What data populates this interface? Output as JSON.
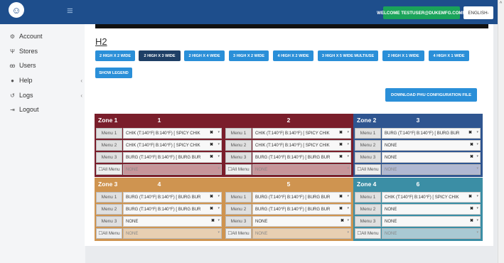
{
  "topbar": {
    "welcome": "WELCOME TESTUSER@DUKEMFG.COM!▾",
    "language": "ENGLISH-"
  },
  "sidebar": {
    "items": [
      {
        "label": "Account",
        "icon": "gear-icon"
      },
      {
        "label": "Stores",
        "icon": "stores-icon"
      },
      {
        "label": "Users",
        "icon": "users-icon"
      },
      {
        "label": "Help",
        "icon": "help-icon"
      },
      {
        "label": "Logs",
        "icon": "logs-icon"
      },
      {
        "label": "Logout",
        "icon": "logout-icon"
      }
    ]
  },
  "main": {
    "title": "H2",
    "layout_buttons": [
      "2 HIGH X 2 WIDE",
      "2 HIGH X 3 WIDE",
      "2 HIGH X 4 WIDE",
      "3 HIGH X 2 WIDE",
      "4 HIGH X 2 WIDE",
      "3 HIGH X 5 WIDE MULTIUSE",
      "2 HIGH X 1 WIDE",
      "4 HIGH X 1 WIDE"
    ],
    "active_layout": "2 HIGH X 3 WIDE",
    "legend_button": "SHOW LEGEND",
    "download_button": "DOWNLOAD PHU CONFIGURATION FILE"
  },
  "colors": {
    "zone1": "#7a1e2b",
    "zone1_bg": "#c7959a",
    "zone2": "#2f5590",
    "zone2_bg": "#b0b8d2",
    "zone3": "#cf9450",
    "zone3_bg": "#e8cfb2",
    "zone4": "#3b8ea5",
    "zone4_bg": "#a9c9d3"
  },
  "blocks": [
    {
      "zone": "Zone 1",
      "num": "1",
      "menus": [
        {
          "label": "Menu 1",
          "value": "CHIK (T:140°F| B:140°F) [ SPICY CHIK"
        },
        {
          "label": "Menu 2",
          "value": "CHIK (T:140°F| B:140°F) [ SPICY CHIK"
        },
        {
          "label": "Menu 3",
          "value": "BURG (T:140°F| B:140°F) [ BURG BUR"
        }
      ],
      "all_label": "☐All Menu",
      "all_value": "NONE"
    },
    {
      "zone": "",
      "num": "2",
      "menus": [
        {
          "label": "Menu 1",
          "value": "CHIK (T:140°F| B:140°F) [ SPICY CHIK"
        },
        {
          "label": "Menu 2",
          "value": "CHIK (T:140°F| B:140°F) [ SPICY CHIK"
        },
        {
          "label": "Menu 3",
          "value": "BURG (T:140°F| B:140°F) [ BURG BUR"
        }
      ],
      "all_label": "☐All Menu",
      "all_value": "NONE"
    },
    {
      "zone": "Zone 2",
      "num": "3",
      "menus": [
        {
          "label": "Menu 1",
          "value": "BURG (T:140°F| B:140°F) [ BURG BUR"
        },
        {
          "label": "Menu 2",
          "value": "NONE"
        },
        {
          "label": "Menu 3",
          "value": "NONE"
        }
      ],
      "all_label": "☐All Menu",
      "all_value": "NONE"
    },
    {
      "zone": "Zone 3",
      "num": "4",
      "menus": [
        {
          "label": "Menu 1",
          "value": "BURG (T:140°F| B:140°F) [ BURG BUR"
        },
        {
          "label": "Menu 2",
          "value": "BURG (T:140°F| B:140°F) [ BURG BUR"
        },
        {
          "label": "Menu 3",
          "value": "NONE"
        }
      ],
      "all_label": "☐All Menu",
      "all_value": "NONE"
    },
    {
      "zone": "",
      "num": "5",
      "menus": [
        {
          "label": "Menu 1",
          "value": "BURG (T:140°F| B:140°F) [ BURG BUR"
        },
        {
          "label": "Menu 2",
          "value": "BURG (T:140°F| B:140°F) [ BURG BUR"
        },
        {
          "label": "Menu 3",
          "value": "NONE"
        }
      ],
      "all_label": "☐All Menu",
      "all_value": "NONE"
    },
    {
      "zone": "Zone 4",
      "num": "6",
      "menus": [
        {
          "label": "Menu 1",
          "value": "CHIK (T:140°F| B:140°F) [ SPICY CHIK"
        },
        {
          "label": "Menu 2",
          "value": "NONE"
        },
        {
          "label": "Menu 3",
          "value": "NONE"
        }
      ],
      "all_label": "☐All Menu",
      "all_value": "NONE"
    }
  ]
}
